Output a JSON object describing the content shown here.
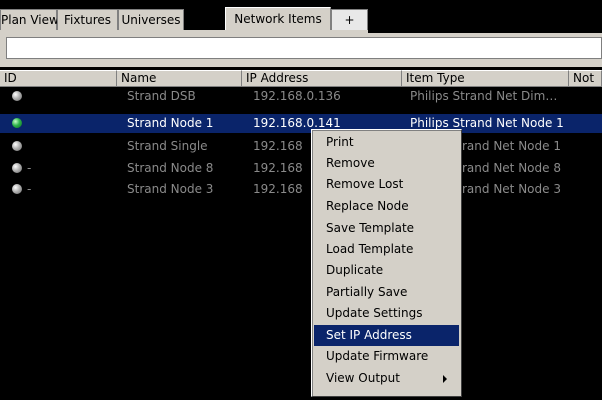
{
  "tabs": [
    {
      "label": "Plan View",
      "active": false
    },
    {
      "label": "Fixtures",
      "active": false
    },
    {
      "label": "Universes",
      "active": false
    },
    {
      "label": "Network Items",
      "active": true
    },
    {
      "label": "+",
      "active": false
    }
  ],
  "search": {
    "value": "",
    "placeholder": ""
  },
  "table": {
    "columns": [
      "ID",
      "Name",
      "IP Address",
      "Item Type",
      "Not"
    ],
    "rows": [
      {
        "status": "offline",
        "id": "",
        "name": "Strand DSB",
        "ip": "192.168.0.136",
        "type": "Philips Strand Net Dim…",
        "selected": false
      },
      {
        "status": "online",
        "id": "",
        "name": "Strand Node 1",
        "ip": "192.168.0.141",
        "type": "Philips Strand Net Node 1",
        "selected": true
      },
      {
        "status": "offline",
        "id": "",
        "name": "Strand Single",
        "ip": "192.168",
        "type": "rand Net Node 1",
        "selected": false
      },
      {
        "status": "offline",
        "id": "-",
        "name": "Strand Node 8",
        "ip": "192.168",
        "type": "rand Net Node 8",
        "selected": false
      },
      {
        "status": "offline",
        "id": "-",
        "name": "Strand Node 3",
        "ip": "192.168",
        "type": "rand Net Node 3",
        "selected": false
      }
    ]
  },
  "context_menu": {
    "items": [
      {
        "label": "Print"
      },
      {
        "label": "Remove"
      },
      {
        "label": "Remove Lost"
      },
      {
        "label": "Replace Node"
      },
      {
        "label": "Save Template"
      },
      {
        "label": "Load Template"
      },
      {
        "label": "Duplicate"
      },
      {
        "label": "Partially Save"
      },
      {
        "label": "Update Settings"
      },
      {
        "label": "Set IP Address",
        "highlighted": true
      },
      {
        "label": "Update Firmware"
      },
      {
        "label": "View Output",
        "submenu": true
      }
    ]
  },
  "colors": {
    "selection": "#0a246a",
    "panel": "#d4d0c8",
    "online": "#2db44a",
    "offline": "#8a8a8a"
  }
}
